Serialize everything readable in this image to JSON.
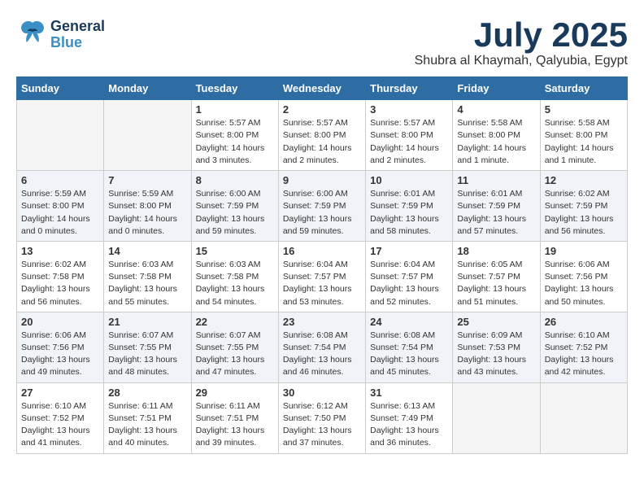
{
  "header": {
    "logo_general": "General",
    "logo_blue": "Blue",
    "month": "July 2025",
    "location": "Shubra al Khaymah, Qalyubia, Egypt"
  },
  "weekdays": [
    "Sunday",
    "Monday",
    "Tuesday",
    "Wednesday",
    "Thursday",
    "Friday",
    "Saturday"
  ],
  "weeks": [
    [
      {
        "day": "",
        "info": "",
        "empty": true
      },
      {
        "day": "",
        "info": "",
        "empty": true
      },
      {
        "day": "1",
        "info": "Sunrise: 5:57 AM\nSunset: 8:00 PM\nDaylight: 14 hours\nand 3 minutes."
      },
      {
        "day": "2",
        "info": "Sunrise: 5:57 AM\nSunset: 8:00 PM\nDaylight: 14 hours\nand 2 minutes."
      },
      {
        "day": "3",
        "info": "Sunrise: 5:57 AM\nSunset: 8:00 PM\nDaylight: 14 hours\nand 2 minutes."
      },
      {
        "day": "4",
        "info": "Sunrise: 5:58 AM\nSunset: 8:00 PM\nDaylight: 14 hours\nand 1 minute."
      },
      {
        "day": "5",
        "info": "Sunrise: 5:58 AM\nSunset: 8:00 PM\nDaylight: 14 hours\nand 1 minute."
      }
    ],
    [
      {
        "day": "6",
        "info": "Sunrise: 5:59 AM\nSunset: 8:00 PM\nDaylight: 14 hours\nand 0 minutes.",
        "shaded": true
      },
      {
        "day": "7",
        "info": "Sunrise: 5:59 AM\nSunset: 8:00 PM\nDaylight: 14 hours\nand 0 minutes.",
        "shaded": true
      },
      {
        "day": "8",
        "info": "Sunrise: 6:00 AM\nSunset: 7:59 PM\nDaylight: 13 hours\nand 59 minutes.",
        "shaded": true
      },
      {
        "day": "9",
        "info": "Sunrise: 6:00 AM\nSunset: 7:59 PM\nDaylight: 13 hours\nand 59 minutes.",
        "shaded": true
      },
      {
        "day": "10",
        "info": "Sunrise: 6:01 AM\nSunset: 7:59 PM\nDaylight: 13 hours\nand 58 minutes.",
        "shaded": true
      },
      {
        "day": "11",
        "info": "Sunrise: 6:01 AM\nSunset: 7:59 PM\nDaylight: 13 hours\nand 57 minutes.",
        "shaded": true
      },
      {
        "day": "12",
        "info": "Sunrise: 6:02 AM\nSunset: 7:59 PM\nDaylight: 13 hours\nand 56 minutes.",
        "shaded": true
      }
    ],
    [
      {
        "day": "13",
        "info": "Sunrise: 6:02 AM\nSunset: 7:58 PM\nDaylight: 13 hours\nand 56 minutes."
      },
      {
        "day": "14",
        "info": "Sunrise: 6:03 AM\nSunset: 7:58 PM\nDaylight: 13 hours\nand 55 minutes."
      },
      {
        "day": "15",
        "info": "Sunrise: 6:03 AM\nSunset: 7:58 PM\nDaylight: 13 hours\nand 54 minutes."
      },
      {
        "day": "16",
        "info": "Sunrise: 6:04 AM\nSunset: 7:57 PM\nDaylight: 13 hours\nand 53 minutes."
      },
      {
        "day": "17",
        "info": "Sunrise: 6:04 AM\nSunset: 7:57 PM\nDaylight: 13 hours\nand 52 minutes."
      },
      {
        "day": "18",
        "info": "Sunrise: 6:05 AM\nSunset: 7:57 PM\nDaylight: 13 hours\nand 51 minutes."
      },
      {
        "day": "19",
        "info": "Sunrise: 6:06 AM\nSunset: 7:56 PM\nDaylight: 13 hours\nand 50 minutes."
      }
    ],
    [
      {
        "day": "20",
        "info": "Sunrise: 6:06 AM\nSunset: 7:56 PM\nDaylight: 13 hours\nand 49 minutes.",
        "shaded": true
      },
      {
        "day": "21",
        "info": "Sunrise: 6:07 AM\nSunset: 7:55 PM\nDaylight: 13 hours\nand 48 minutes.",
        "shaded": true
      },
      {
        "day": "22",
        "info": "Sunrise: 6:07 AM\nSunset: 7:55 PM\nDaylight: 13 hours\nand 47 minutes.",
        "shaded": true
      },
      {
        "day": "23",
        "info": "Sunrise: 6:08 AM\nSunset: 7:54 PM\nDaylight: 13 hours\nand 46 minutes.",
        "shaded": true
      },
      {
        "day": "24",
        "info": "Sunrise: 6:08 AM\nSunset: 7:54 PM\nDaylight: 13 hours\nand 45 minutes.",
        "shaded": true
      },
      {
        "day": "25",
        "info": "Sunrise: 6:09 AM\nSunset: 7:53 PM\nDaylight: 13 hours\nand 43 minutes.",
        "shaded": true
      },
      {
        "day": "26",
        "info": "Sunrise: 6:10 AM\nSunset: 7:52 PM\nDaylight: 13 hours\nand 42 minutes.",
        "shaded": true
      }
    ],
    [
      {
        "day": "27",
        "info": "Sunrise: 6:10 AM\nSunset: 7:52 PM\nDaylight: 13 hours\nand 41 minutes."
      },
      {
        "day": "28",
        "info": "Sunrise: 6:11 AM\nSunset: 7:51 PM\nDaylight: 13 hours\nand 40 minutes."
      },
      {
        "day": "29",
        "info": "Sunrise: 6:11 AM\nSunset: 7:51 PM\nDaylight: 13 hours\nand 39 minutes."
      },
      {
        "day": "30",
        "info": "Sunrise: 6:12 AM\nSunset: 7:50 PM\nDaylight: 13 hours\nand 37 minutes."
      },
      {
        "day": "31",
        "info": "Sunrise: 6:13 AM\nSunset: 7:49 PM\nDaylight: 13 hours\nand 36 minutes."
      },
      {
        "day": "",
        "info": "",
        "empty": true
      },
      {
        "day": "",
        "info": "",
        "empty": true
      }
    ]
  ]
}
